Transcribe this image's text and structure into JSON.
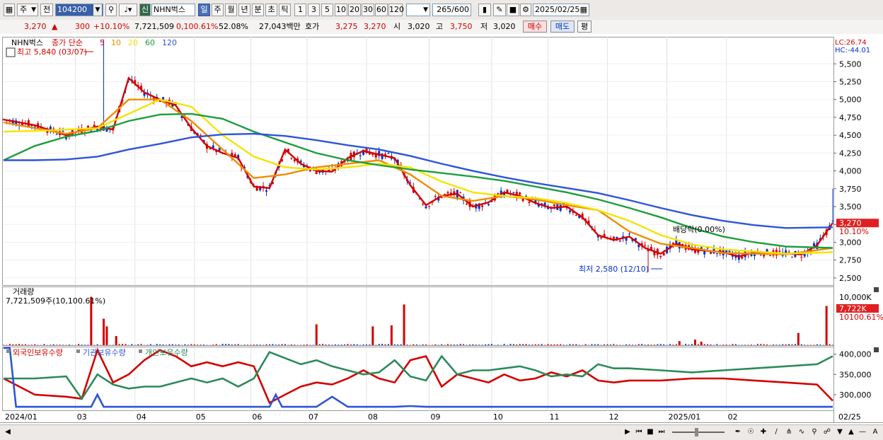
{
  "toolbar": {
    "period_type": "주",
    "market": "전",
    "code": "104200",
    "badge": "신",
    "name": "NHN벅스",
    "intervals": [
      "일",
      "주",
      "월",
      "년",
      "분",
      "초",
      "틱"
    ],
    "active_interval": "일",
    "nums": [
      "1",
      "3",
      "5",
      "10",
      "20",
      "30",
      "60",
      "120"
    ],
    "count": "265",
    "total": "/600",
    "date": "2025/02/25"
  },
  "info": {
    "price": "3,270",
    "change": "300",
    "change_rate": "+10.10%",
    "volume": "7,721,509",
    "volume_ratio": "0,100.61%",
    "turnover": "52.08%",
    "amount": "27,043백만",
    "quote_label": "호가",
    "ask": "3,275",
    "bid": "3,270",
    "open_label": "시",
    "open": "3,020",
    "high_label": "고",
    "high": "3,750",
    "low_label": "저",
    "low": "3,020",
    "buy": "매수",
    "sell": "매도",
    "eval": "평"
  },
  "colors": {
    "up": "#d40000",
    "down": "#0033cc",
    "ma5": "#d40000",
    "ma10": "#f08c00",
    "ma20": "#f5e300",
    "ma60": "#1e9e3c",
    "ma120": "#2d55d8"
  },
  "chart_data": [
    {
      "type": "line",
      "title": "",
      "legend": {
        "stock": "NHN벅스",
        "label": "종가 단순",
        "periods": [
          "5",
          "10",
          "20",
          "60",
          "120"
        ]
      },
      "annotations": {
        "high": "최고 5,840 (03/07)",
        "low": "최저 2,580 (12/10)",
        "dividend": "배당락(0.00%)"
      },
      "corner": {
        "lc": "LC:26.74",
        "hc": "HC:-44.01"
      },
      "price_tag": {
        "price": "3,270",
        "rate": "10.10%"
      },
      "y_ticks": [
        "5,500",
        "5,250",
        "5,000",
        "4,750",
        "4,500",
        "4,250",
        "4,000",
        "3,750",
        "3,500",
        "3,250",
        "3,000",
        "2,750",
        "2,500"
      ],
      "ylim": [
        2400,
        5800
      ],
      "x_labels": [
        "2024/01",
        "03",
        "04",
        "05",
        "06",
        "07",
        "08",
        "09",
        "10",
        "11",
        "12",
        "2025/01",
        "02"
      ],
      "date_label": "02/25",
      "series": [
        {
          "name": "5",
          "color": "#d40000",
          "x": [
            0,
            10,
            20,
            25,
            30,
            35,
            40,
            45,
            50,
            55,
            60,
            65,
            70,
            75,
            80,
            85,
            90,
            95,
            100,
            105,
            110,
            115,
            120,
            125,
            130,
            135,
            140,
            145,
            150,
            155,
            160,
            165,
            170,
            175,
            180,
            185,
            190,
            195,
            200,
            205,
            210,
            215,
            220,
            225,
            230,
            235,
            240,
            245,
            250,
            255,
            260,
            265
          ],
          "values": [
            4720,
            4640,
            4500,
            4570,
            4620,
            4580,
            5300,
            5100,
            5000,
            4920,
            4600,
            4350,
            4250,
            4180,
            3780,
            3760,
            4300,
            4100,
            4000,
            3990,
            4180,
            4280,
            4230,
            4180,
            3800,
            3520,
            3650,
            3680,
            3500,
            3560,
            3700,
            3650,
            3550,
            3480,
            3500,
            3350,
            3100,
            3030,
            3080,
            2920,
            2840,
            2980,
            2900,
            2880,
            2860,
            2800,
            2860,
            2850,
            2840,
            2830,
            2960,
            3270
          ]
        },
        {
          "name": "10",
          "color": "#f08c00",
          "x": [
            0,
            10,
            20,
            30,
            40,
            50,
            60,
            70,
            80,
            90,
            100,
            110,
            120,
            130,
            140,
            150,
            160,
            170,
            180,
            190,
            200,
            210,
            220,
            230,
            240,
            250,
            265
          ],
          "values": [
            4680,
            4600,
            4520,
            4600,
            5000,
            5000,
            4700,
            4300,
            3900,
            3950,
            4050,
            4100,
            4150,
            3950,
            3650,
            3580,
            3650,
            3600,
            3520,
            3450,
            3150,
            2980,
            2920,
            2850,
            2840,
            2830,
            2920
          ]
        },
        {
          "name": "20",
          "color": "#f5e300",
          "x": [
            0,
            10,
            20,
            30,
            40,
            50,
            60,
            70,
            80,
            90,
            100,
            110,
            120,
            130,
            140,
            150,
            160,
            170,
            180,
            190,
            200,
            210,
            220,
            230,
            240,
            250,
            265
          ],
          "values": [
            4550,
            4560,
            4580,
            4600,
            4800,
            5000,
            4900,
            4500,
            4200,
            4050,
            4020,
            4050,
            4100,
            4050,
            3850,
            3700,
            3650,
            3620,
            3550,
            3450,
            3300,
            3100,
            2970,
            2900,
            2870,
            2840,
            2860
          ]
        },
        {
          "name": "60",
          "color": "#1e9e3c",
          "x": [
            0,
            10,
            20,
            30,
            40,
            50,
            60,
            70,
            80,
            90,
            100,
            110,
            120,
            130,
            140,
            150,
            160,
            170,
            180,
            190,
            200,
            210,
            220,
            230,
            240,
            250,
            265
          ],
          "values": [
            4150,
            4350,
            4480,
            4560,
            4700,
            4790,
            4800,
            4730,
            4550,
            4400,
            4250,
            4150,
            4080,
            4020,
            3970,
            3920,
            3860,
            3780,
            3700,
            3600,
            3480,
            3350,
            3200,
            3080,
            3000,
            2940,
            2920
          ]
        },
        {
          "name": "120",
          "color": "#2d55d8",
          "x": [
            0,
            10,
            20,
            30,
            40,
            50,
            60,
            70,
            80,
            90,
            100,
            110,
            120,
            130,
            140,
            150,
            160,
            170,
            180,
            190,
            200,
            210,
            220,
            230,
            240,
            250,
            265
          ],
          "values": [
            4150,
            4150,
            4160,
            4200,
            4300,
            4380,
            4470,
            4510,
            4520,
            4490,
            4430,
            4360,
            4300,
            4210,
            4100,
            4000,
            3910,
            3830,
            3760,
            3690,
            3590,
            3480,
            3380,
            3300,
            3240,
            3200,
            3210
          ]
        }
      ]
    },
    {
      "type": "bar",
      "title": "거래량",
      "label": "7,721,509주(10,100.61%)",
      "y_ticks": [
        "10,000K"
      ],
      "tag": {
        "value": "7,722K",
        "rate": "10100.61%"
      },
      "spikes_x": [
        28,
        32,
        33,
        36,
        100,
        118,
        124,
        128,
        216,
        221,
        223,
        254,
        263
      ],
      "spikes_value": [
        9500,
        5200,
        3700,
        1800,
        4100,
        3700,
        3900,
        8000,
        800,
        1100,
        700,
        2400,
        7700
      ]
    },
    {
      "type": "line",
      "title": "외국인보유수량",
      "legend": [
        "외국인보유수량",
        "기관보유수량",
        "개인보유수량"
      ],
      "y_ticks": [
        "400,000",
        "350,000",
        "300,000"
      ],
      "ylim": [
        265000,
        415000
      ],
      "series": [
        {
          "name": "외국인보유수량",
          "color": "#d40000",
          "x": [
            0,
            10,
            20,
            25,
            30,
            35,
            40,
            45,
            50,
            55,
            60,
            65,
            70,
            75,
            80,
            85,
            90,
            95,
            100,
            105,
            110,
            115,
            120,
            125,
            130,
            135,
            140,
            145,
            150,
            155,
            160,
            165,
            170,
            175,
            180,
            185,
            190,
            195,
            200,
            210,
            220,
            230,
            240,
            250,
            260,
            265
          ],
          "values": [
            340000,
            300000,
            295000,
            290000,
            410000,
            330000,
            350000,
            385000,
            410000,
            395000,
            370000,
            380000,
            370000,
            380000,
            370000,
            280000,
            300000,
            320000,
            330000,
            325000,
            340000,
            360000,
            340000,
            330000,
            385000,
            395000,
            320000,
            350000,
            340000,
            330000,
            350000,
            335000,
            340000,
            355000,
            345000,
            360000,
            335000,
            330000,
            335000,
            335000,
            340000,
            340000,
            335000,
            330000,
            325000,
            285000
          ]
        },
        {
          "name": "기관보유수량",
          "color": "#2d8a5a",
          "x": [
            0,
            10,
            20,
            25,
            30,
            35,
            40,
            45,
            50,
            55,
            60,
            65,
            70,
            75,
            80,
            85,
            90,
            95,
            100,
            105,
            110,
            115,
            120,
            125,
            130,
            135,
            140,
            145,
            150,
            155,
            160,
            165,
            170,
            175,
            180,
            185,
            190,
            195,
            200,
            210,
            220,
            230,
            240,
            250,
            260,
            265
          ],
          "values": [
            340000,
            340000,
            345000,
            290000,
            350000,
            325000,
            315000,
            320000,
            320000,
            330000,
            340000,
            330000,
            340000,
            320000,
            340000,
            405000,
            390000,
            375000,
            385000,
            370000,
            360000,
            350000,
            355000,
            385000,
            345000,
            335000,
            395000,
            350000,
            360000,
            360000,
            365000,
            370000,
            360000,
            345000,
            350000,
            345000,
            375000,
            365000,
            365000,
            360000,
            355000,
            360000,
            365000,
            370000,
            375000,
            395000
          ]
        },
        {
          "name": "개인보유수량",
          "color": "#2d55d8",
          "x": [
            0,
            2,
            4,
            6,
            8,
            10,
            28,
            30,
            32,
            35,
            60,
            85,
            87,
            89,
            91,
            93,
            95,
            100,
            105,
            110,
            115,
            120,
            125,
            130,
            135,
            140,
            145,
            150,
            155,
            160,
            165,
            170,
            175,
            180,
            185,
            190,
            195,
            200,
            210,
            220,
            230,
            240,
            250,
            260,
            265
          ],
          "values": [
            415000,
            415000,
            270000,
            270000,
            270000,
            270000,
            270000,
            300000,
            270000,
            270000,
            270000,
            270000,
            300000,
            270000,
            270000,
            270000,
            270000,
            270000,
            295000,
            270000,
            270000,
            270000,
            270000,
            272000,
            270000,
            270000,
            270000,
            270000,
            270000,
            270000,
            270000,
            270000,
            270000,
            270000,
            270000,
            270000,
            270000,
            270000,
            270000,
            270000,
            270000,
            270000,
            270000,
            270000,
            270000
          ]
        }
      ]
    }
  ]
}
